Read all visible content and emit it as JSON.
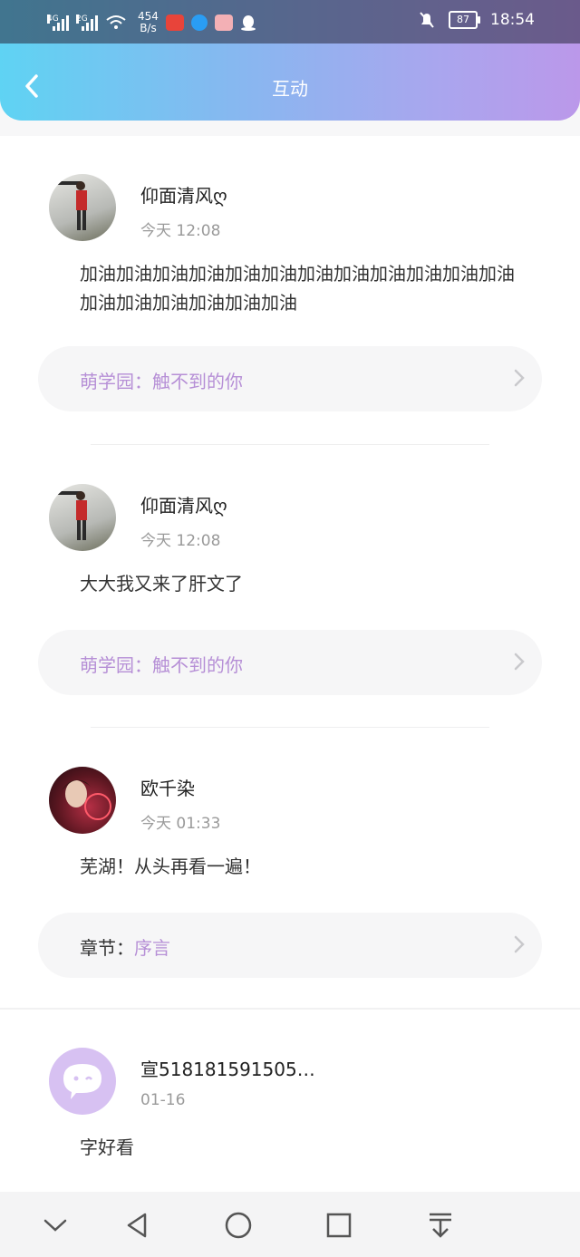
{
  "status_bar": {
    "signal1_label": "4G",
    "signal2_label": "2G",
    "net_speed_value": "454",
    "net_speed_unit": "B/s",
    "battery": "87",
    "time": "18:54"
  },
  "header": {
    "title": "互动"
  },
  "posts": [
    {
      "username": "仰面清风ღ",
      "time": "今天 12:08",
      "text": "加油加油加油加油加油加油加油加油加油加油加油加油加油加油加油加油加油加油",
      "ref_prefix": "",
      "ref_label": "萌学园：触不到的你"
    },
    {
      "username": "仰面清风ღ",
      "time": "今天 12:08",
      "text": "大大我又来了肝文了",
      "ref_prefix": "",
      "ref_label": "萌学园：触不到的你"
    },
    {
      "username": "欧千染",
      "time": "今天 01:33",
      "text": "芜湖！从头再看一遍！",
      "ref_prefix": "章节：",
      "ref_label": "序言"
    },
    {
      "username": "宣518181591505…",
      "time": "01-16",
      "text": "字好看"
    }
  ],
  "colors": {
    "accent": "#b68fd6",
    "header_gradient_start": "#5fd3f3",
    "header_gradient_end": "#bb98ea"
  }
}
